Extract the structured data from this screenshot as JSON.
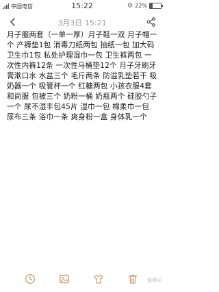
{
  "status_bar": {
    "carrier": "中国电信",
    "time": "15:22",
    "battery": "22%",
    "battery_level": 0.22
  },
  "header": {
    "title": "3月3日 15:21"
  },
  "note": {
    "content": "月子服两套（一单一厚）月子鞋一双 月子帽一个 产褥垫1包 消毒刀纸两包 抽纸一包 加大码卫生巾1包 私处护理湿巾一包 卫生裤两包 一次性内裤12条 一次性马桶垫12个 月子牙刷牙膏漱口水 水盆三个 毛斤两条 防溢乳垫若干 吸奶器一个 吸管杯一个 红糖两包 小孩衣服4套 和尚服 包被三个 奶粉一桶 奶瓶两个 硅胶勺子一个 尿不湿丰包45片 湿巾一包 棉柔巾一包 尿布三条 浴巾一条 爽身粉一盒 身体乳一个"
  },
  "watermark": "值得买",
  "colors": {
    "icon": "#c9a27a",
    "title": "#999999"
  }
}
